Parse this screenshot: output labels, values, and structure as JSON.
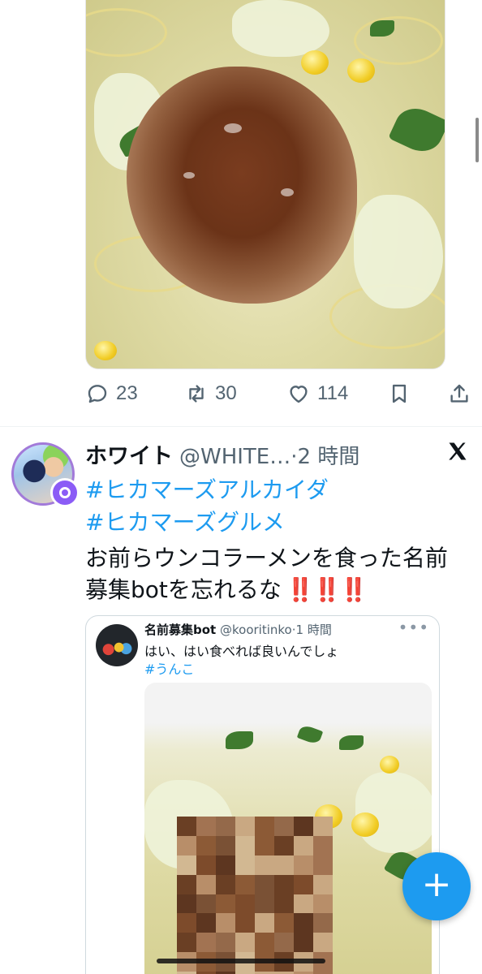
{
  "first_tweet": {
    "image_alt": "ramen with topping",
    "reply_count": "23",
    "retweet_count": "30",
    "like_count": "114"
  },
  "second_tweet": {
    "author_name": "ホワイト",
    "author_handle": "@WHITE…",
    "time": "·2 時間",
    "hashtags": [
      "#ヒカマーズアルカイダ",
      "#ヒカマーズグルメ"
    ],
    "text_lines": [
      "お前らウンコラーメンを食った名前",
      "募集botを忘れるな"
    ],
    "emphasis": "‼️‼️‼️"
  },
  "quoted_tweet": {
    "author_name": "名前募集bot",
    "author_handle": "@kooritinko",
    "time": "·1 時間",
    "text": "はい、はい食べれば良いんでしょ",
    "hashtag": "#うんこ"
  },
  "colors": {
    "accent": "#1d9bf0",
    "muted": "#536471",
    "badge": "#8b5cf6",
    "emphasis": "#e0245e"
  },
  "icons": [
    "reply-icon",
    "retweet-icon",
    "like-icon",
    "bookmark-icon",
    "share-icon",
    "x-logo-icon",
    "compose-icon"
  ]
}
